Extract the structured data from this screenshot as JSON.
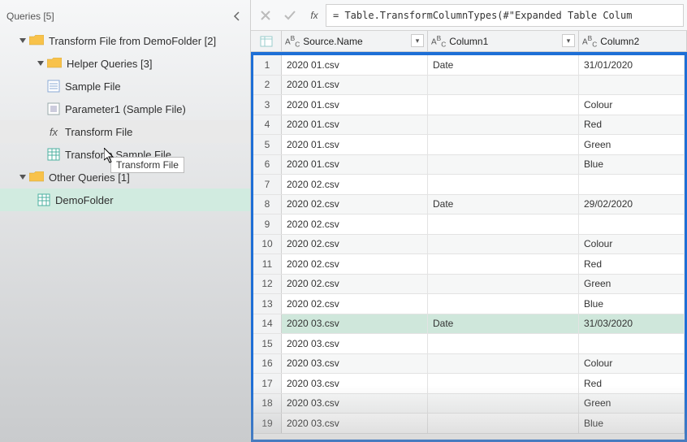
{
  "queries_panel": {
    "title": "Queries [5]",
    "groups": {
      "transform_folder": {
        "label": "Transform File from DemoFolder [2]"
      },
      "helper": {
        "label": "Helper Queries [3]"
      },
      "other": {
        "label": "Other Queries [1]"
      }
    },
    "items": {
      "sample_file": "Sample File",
      "parameter1": "Parameter1 (Sample File)",
      "transform_file": "Transform File",
      "transform_sample_file": "Transform Sample File",
      "demofolder": "DemoFolder"
    },
    "tooltip": "Transform File"
  },
  "formula_bar": {
    "fx": "fx",
    "formula": "= Table.TransformColumnTypes(#\"Expanded Table Colum"
  },
  "columns": {
    "source": "Source.Name",
    "c1": "Column1",
    "c2": "Column2",
    "type_icon": "Aᴯc"
  },
  "rows": [
    {
      "n": "1",
      "src": "2020 01.csv",
      "c1": "Date",
      "c2": "31/01/2020"
    },
    {
      "n": "2",
      "src": "2020 01.csv",
      "c1": "",
      "c2": ""
    },
    {
      "n": "3",
      "src": "2020 01.csv",
      "c1": "",
      "c2": "Colour"
    },
    {
      "n": "4",
      "src": "2020 01.csv",
      "c1": "",
      "c2": "Red"
    },
    {
      "n": "5",
      "src": "2020 01.csv",
      "c1": "",
      "c2": "Green"
    },
    {
      "n": "6",
      "src": "2020 01.csv",
      "c1": "",
      "c2": "Blue"
    },
    {
      "n": "7",
      "src": "2020 02.csv",
      "c1": "",
      "c2": ""
    },
    {
      "n": "8",
      "src": "2020 02.csv",
      "c1": "Date",
      "c2": "29/02/2020"
    },
    {
      "n": "9",
      "src": "2020 02.csv",
      "c1": "",
      "c2": ""
    },
    {
      "n": "10",
      "src": "2020 02.csv",
      "c1": "",
      "c2": "Colour"
    },
    {
      "n": "11",
      "src": "2020 02.csv",
      "c1": "",
      "c2": "Red"
    },
    {
      "n": "12",
      "src": "2020 02.csv",
      "c1": "",
      "c2": "Green"
    },
    {
      "n": "13",
      "src": "2020 02.csv",
      "c1": "",
      "c2": "Blue"
    },
    {
      "n": "14",
      "src": "2020 03.csv",
      "c1": "Date",
      "c2": "31/03/2020"
    },
    {
      "n": "15",
      "src": "2020 03.csv",
      "c1": "",
      "c2": ""
    },
    {
      "n": "16",
      "src": "2020 03.csv",
      "c1": "",
      "c2": "Colour"
    },
    {
      "n": "17",
      "src": "2020 03.csv",
      "c1": "",
      "c2": "Red"
    },
    {
      "n": "18",
      "src": "2020 03.csv",
      "c1": "",
      "c2": "Green"
    },
    {
      "n": "19",
      "src": "2020 03.csv",
      "c1": "",
      "c2": "Blue"
    }
  ],
  "selected_row": 14
}
